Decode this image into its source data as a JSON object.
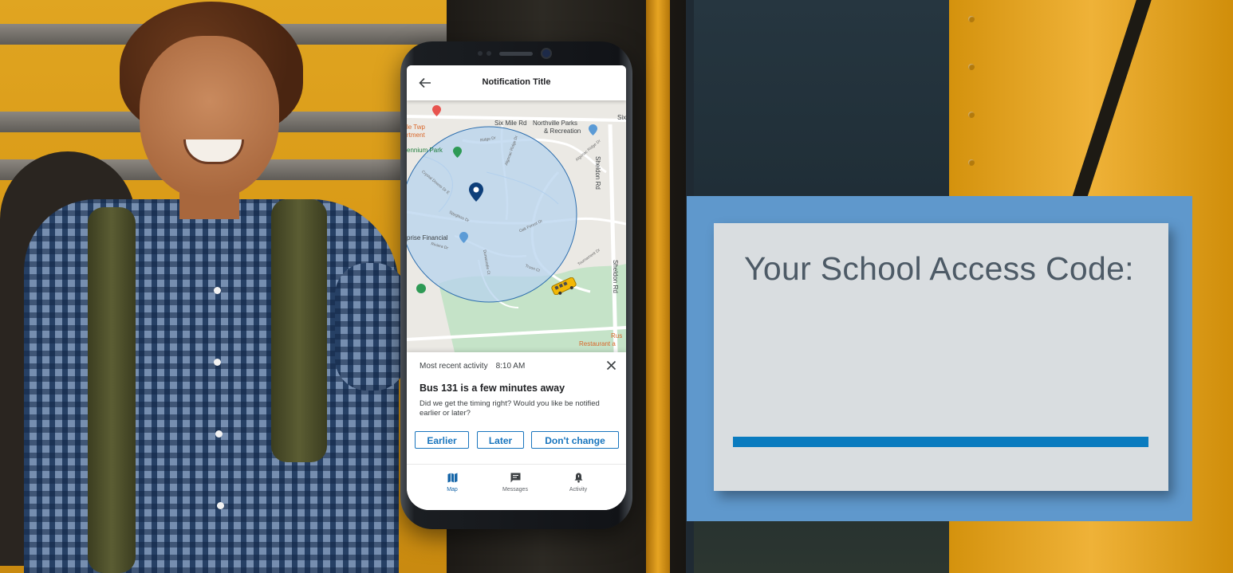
{
  "phone": {
    "appbar": {
      "title": "Notification Title",
      "back_icon": "arrow-left-icon"
    },
    "map": {
      "labels": {
        "six_mile": "Six Mile Rd",
        "parks_line1": "Northville Parks",
        "parks_line2": "& Recreation",
        "twp_line1": "le Twp",
        "twp_line2": "rtment",
        "park": "ennium Park",
        "financial": "prise Financial",
        "sheldon_top": "Sheldon Rd",
        "sheldon_bottom": "Sheldon Rd",
        "six_right": "Six",
        "rus": "Rus",
        "restaurant": "Restaurant a",
        "road_a": "Algonac Ridge Dr",
        "road_b": "Algonac Ridge Dr",
        "road_c": "Crystal Downs Dr E",
        "road_d": "Spyglass Dr",
        "road_e": "Oak Forest Dr",
        "road_f": "Riviera Dr",
        "road_g": "Dunwoodie Ct",
        "road_h": "Troon Ct",
        "road_i": "Tournament Dr",
        "road_j": "Ridge Dr"
      },
      "icons": [
        "location-pin-icon",
        "school-bus-icon",
        "place-marker-icon"
      ],
      "colors": {
        "radius_fill": "#b7d3ee",
        "radius_stroke": "#2f6fae",
        "pin": "#0d3f7a",
        "bus": "#f2b705"
      }
    },
    "activity": {
      "heading": "Most recent activity",
      "time": "8:10 AM",
      "title": "Bus 131 is a few minutes away",
      "body": "Did we get the timing right? Would you like be notified earlier or later?",
      "buttons": {
        "earlier": "Earlier",
        "later": "Later",
        "dont_change": "Don't change"
      },
      "accent": "#1875be"
    },
    "tabs": [
      {
        "label": "Map",
        "icon": "map-icon",
        "active": true
      },
      {
        "label": "Messages",
        "icon": "message-icon",
        "active": false
      },
      {
        "label": "Activity",
        "icon": "bell-icon",
        "active": false
      }
    ]
  },
  "card": {
    "title": "Your School Access Code:",
    "colors": {
      "frame": "#5f98cc",
      "panel": "#d9dde0",
      "line": "#0a7bbf",
      "text": "#4d5a66"
    }
  }
}
